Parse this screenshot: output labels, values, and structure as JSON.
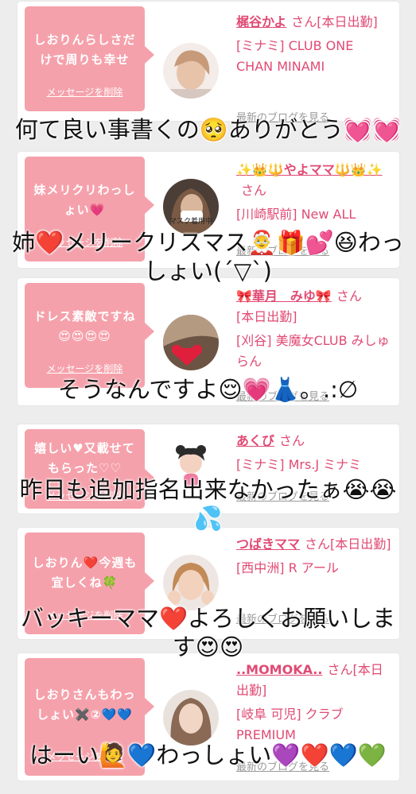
{
  "colors": {
    "background": "#ededed",
    "bubble": "#f5a1ab",
    "accent_text": "#e04a73",
    "muted_text": "#9a9a9a",
    "caption_text": "#111111"
  },
  "cards": [
    {
      "message": "しおりんらしさだけで周りも幸せ",
      "delete_label": "メッセージを削除",
      "name": "梶谷かよ",
      "honorific": "さん",
      "status": "[本日出勤]",
      "shop": "[ミナミ] CLUB ONE CHAN MINAMI",
      "blog_label": "最新のブログを見る",
      "avatar_icon": "blonde-woman-photo"
    },
    {
      "message": "妹メリクリわっしょい",
      "message_emoji": "💗",
      "delete_label": "メッセージを削除",
      "name": "✨👑🔱やよママ🔱👑✨",
      "honorific": "さん",
      "status": "",
      "shop": "[川崎駅前] New ALL",
      "blog_label": "最新のブログを見る",
      "avatar_icon": "dark-haired-woman-photo",
      "avatar_caption": "マスク着用中"
    },
    {
      "message": "ドレス素敵ですね",
      "message_emoji": "😍😍😍😍",
      "delete_label": "メッセージを削除",
      "name": "🎀華月　みゆ🎀",
      "honorific": "さん",
      "status": "[本日出勤]",
      "shop": "[刈谷] 美魔女CLUB みしゅらん",
      "blog_label": "最新のブログを見る",
      "avatar_icon": "woman-with-red-heart-photo"
    },
    {
      "message": "嬉しい♥又載せてもらった♡♡",
      "delete_label": "メッセージを削除",
      "name": "あくび",
      "honorific": "さん",
      "status": "",
      "shop": "[ミナミ] Mrs.J ミナミ",
      "blog_label": "最新のブログを見る",
      "avatar_icon": "cartoon-girl-illustration"
    },
    {
      "message": "しおりん❤️今週も宜しくね🍀",
      "delete_label": "メッセージを削除",
      "name": "つばきママ",
      "honorific": "さん",
      "status": "[本日出勤]",
      "shop": "[西中洲] R アール",
      "blog_label": "最新のブログを見る",
      "avatar_icon": "smiling-woman-photo"
    },
    {
      "message": "しおりさんもわっしょい✖️②💙💙",
      "delete_label": "メッセージを削除",
      "name": "..MOMOKA..",
      "honorific": "さん",
      "status": "[本日出勤]",
      "shop": "[岐阜 可児] クラブ PREMIUM",
      "blog_label": "最新のブログを見る",
      "avatar_icon": "long-haired-woman-photo"
    }
  ],
  "captions": [
    {
      "line1": "何て良い事書くの🥺ありがとう💓💓"
    },
    {
      "line1": "姉❤️メリークリスマス🤶🎁💕😆わっ",
      "line2": "しょい(´▽`)"
    },
    {
      "line1": "そうなんですよ😌💗👗。.:∅"
    },
    {
      "line1": "昨日も追加指名出来なかったぁ😭😭",
      "line2": "💦"
    },
    {
      "line1": "バッキーママ❤️よろしくお願いしま",
      "line2": "す😍😍"
    },
    {
      "line1": "はーい🙋💙わっしょい💜❤️💙💚"
    }
  ]
}
